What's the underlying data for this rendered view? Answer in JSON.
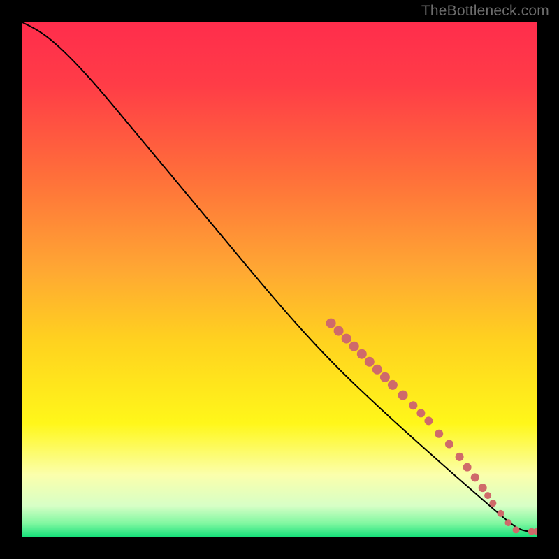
{
  "watermark": "TheBottleneck.com",
  "colors": {
    "marker_fill": "#cf6a6a",
    "marker_stroke": "#9e4d4d",
    "curve": "#000000",
    "gradient_stops": [
      {
        "offset": "0%",
        "color": "#ff2d4c"
      },
      {
        "offset": "12%",
        "color": "#ff3c47"
      },
      {
        "offset": "30%",
        "color": "#ff6f3a"
      },
      {
        "offset": "48%",
        "color": "#ffa733"
      },
      {
        "offset": "62%",
        "color": "#ffd21f"
      },
      {
        "offset": "78%",
        "color": "#fff71a"
      },
      {
        "offset": "88%",
        "color": "#fbffac"
      },
      {
        "offset": "94%",
        "color": "#d7ffc6"
      },
      {
        "offset": "97.5%",
        "color": "#7ef7a0"
      },
      {
        "offset": "100%",
        "color": "#17e07a"
      }
    ]
  },
  "chart_data": {
    "type": "line",
    "title": "",
    "xlabel": "",
    "ylabel": "",
    "xlim": [
      0,
      100
    ],
    "ylim": [
      0,
      100
    ],
    "curve": [
      {
        "x": 0,
        "y": 100
      },
      {
        "x": 3,
        "y": 98.5
      },
      {
        "x": 6,
        "y": 96.3
      },
      {
        "x": 10,
        "y": 92.5
      },
      {
        "x": 15,
        "y": 87.0
      },
      {
        "x": 20,
        "y": 81.0
      },
      {
        "x": 30,
        "y": 69.0
      },
      {
        "x": 40,
        "y": 57.0
      },
      {
        "x": 50,
        "y": 45.0
      },
      {
        "x": 60,
        "y": 34.0
      },
      {
        "x": 70,
        "y": 24.5
      },
      {
        "x": 80,
        "y": 15.5
      },
      {
        "x": 88,
        "y": 8.5
      },
      {
        "x": 92,
        "y": 5.0
      },
      {
        "x": 95,
        "y": 2.5
      },
      {
        "x": 97,
        "y": 1.2
      },
      {
        "x": 100,
        "y": 0.8
      }
    ],
    "markers": [
      {
        "x": 60.0,
        "y": 41.5,
        "r": 7
      },
      {
        "x": 61.5,
        "y": 40.0,
        "r": 7
      },
      {
        "x": 63.0,
        "y": 38.5,
        "r": 7
      },
      {
        "x": 64.5,
        "y": 37.0,
        "r": 7
      },
      {
        "x": 66.0,
        "y": 35.5,
        "r": 7
      },
      {
        "x": 67.5,
        "y": 34.0,
        "r": 7
      },
      {
        "x": 69.0,
        "y": 32.5,
        "r": 7
      },
      {
        "x": 70.5,
        "y": 31.0,
        "r": 7
      },
      {
        "x": 72.0,
        "y": 29.5,
        "r": 7
      },
      {
        "x": 74.0,
        "y": 27.5,
        "r": 7
      },
      {
        "x": 76.0,
        "y": 25.5,
        "r": 6
      },
      {
        "x": 77.5,
        "y": 24.0,
        "r": 6
      },
      {
        "x": 79.0,
        "y": 22.5,
        "r": 6
      },
      {
        "x": 81.0,
        "y": 20.0,
        "r": 6
      },
      {
        "x": 83.0,
        "y": 18.0,
        "r": 6
      },
      {
        "x": 85.0,
        "y": 15.5,
        "r": 6
      },
      {
        "x": 86.5,
        "y": 13.5,
        "r": 6
      },
      {
        "x": 88.0,
        "y": 11.5,
        "r": 6
      },
      {
        "x": 89.5,
        "y": 9.5,
        "r": 6
      },
      {
        "x": 90.5,
        "y": 8.0,
        "r": 5
      },
      {
        "x": 91.5,
        "y": 6.5,
        "r": 5
      },
      {
        "x": 93.0,
        "y": 4.5,
        "r": 5
      },
      {
        "x": 94.5,
        "y": 2.7,
        "r": 5
      },
      {
        "x": 96.0,
        "y": 1.3,
        "r": 5
      },
      {
        "x": 99.0,
        "y": 1.0,
        "r": 5
      },
      {
        "x": 100.0,
        "y": 1.0,
        "r": 5
      }
    ]
  }
}
